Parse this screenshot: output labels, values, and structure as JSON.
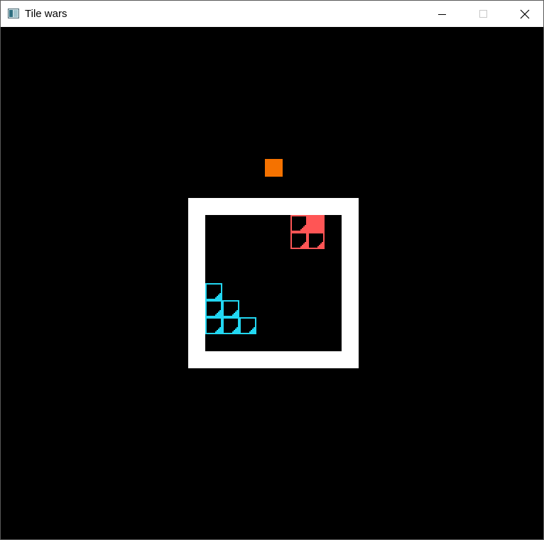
{
  "window": {
    "title": "Tile wars"
  },
  "icons": {
    "app": "app-window-icon",
    "minimize": "minimize-icon",
    "maximize": "maximize-icon",
    "close": "close-icon"
  },
  "game": {
    "next_piece_color": "#f57200",
    "board_frame_color": "#ffffff",
    "board_grid_size": 8,
    "players": [
      {
        "color": "#ff5555",
        "tiles": [
          {
            "col": 5,
            "row": 0,
            "style": "outline"
          },
          {
            "col": 6,
            "row": 0,
            "style": "filled"
          },
          {
            "col": 5,
            "row": 1,
            "style": "outline"
          },
          {
            "col": 6,
            "row": 1,
            "style": "outline"
          }
        ]
      },
      {
        "color": "#22d7f2",
        "tiles": [
          {
            "col": 0,
            "row": 4,
            "style": "outline"
          },
          {
            "col": 0,
            "row": 5,
            "style": "outline"
          },
          {
            "col": 1,
            "row": 5,
            "style": "outline"
          },
          {
            "col": 0,
            "row": 6,
            "style": "outline"
          },
          {
            "col": 1,
            "row": 6,
            "style": "outline"
          },
          {
            "col": 2,
            "row": 6,
            "style": "outline"
          }
        ]
      }
    ]
  }
}
